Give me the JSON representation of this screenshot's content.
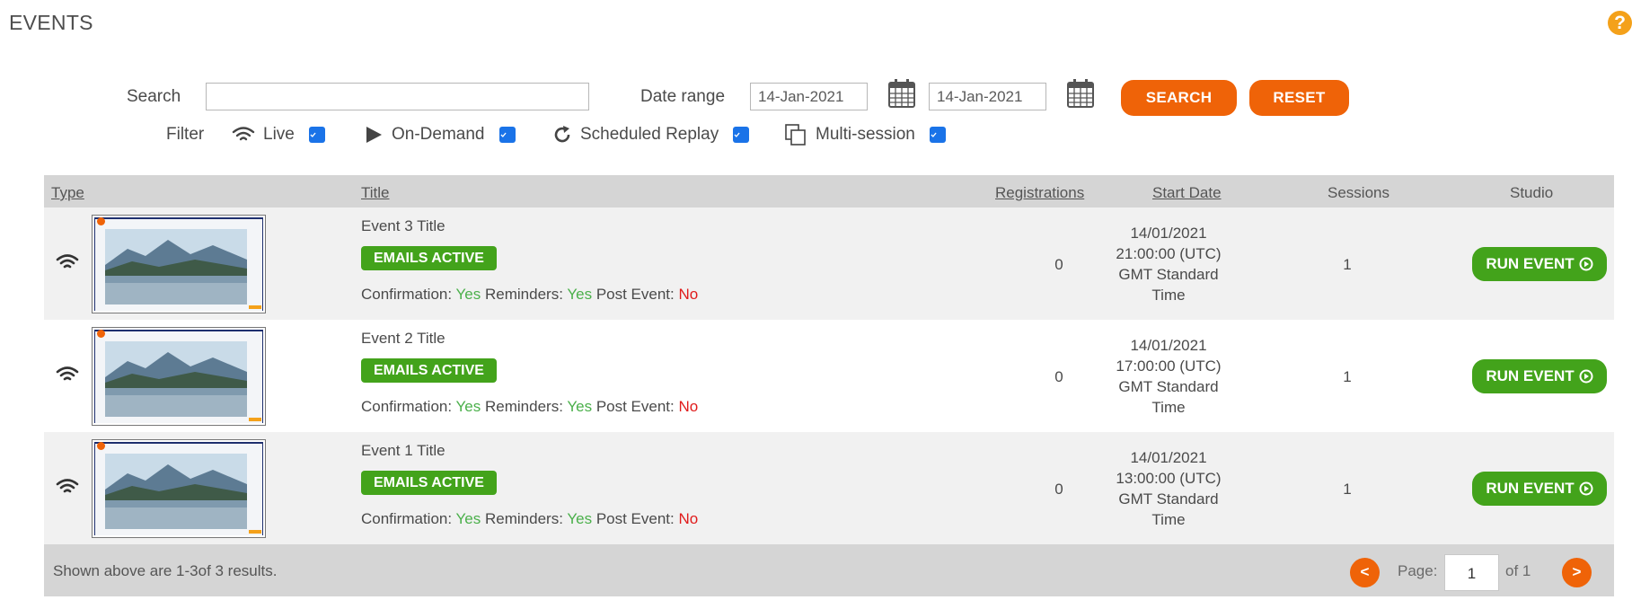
{
  "page": {
    "title": "EVENTS",
    "help_symbol": "?"
  },
  "search": {
    "label": "Search",
    "value": "",
    "placeholder": ""
  },
  "date_range": {
    "label": "Date range",
    "from": "14-Jan-2021",
    "to": "14-Jan-2021"
  },
  "buttons": {
    "search": "SEARCH",
    "reset": "RESET"
  },
  "filter": {
    "label": "Filter",
    "items": [
      {
        "label": "Live",
        "icon": "wifi-icon",
        "checked": true
      },
      {
        "label": "On-Demand",
        "icon": "play-icon",
        "checked": true
      },
      {
        "label": "Scheduled Replay",
        "icon": "replay-icon",
        "checked": true
      },
      {
        "label": "Multi-session",
        "icon": "copy-icon",
        "checked": true
      }
    ]
  },
  "table": {
    "headers": {
      "type": "Type",
      "title": "Title",
      "registrations": "Registrations",
      "start_date": "Start Date",
      "sessions": "Sessions",
      "studio": "Studio"
    },
    "rows": [
      {
        "title": "Event 3 Title",
        "badge": "EMAILS ACTIVE",
        "confirmation_label": "Confirmation:",
        "confirmation": "Yes",
        "reminders_label": "Reminders:",
        "reminders": "Yes",
        "post_event_label": "Post Event:",
        "post_event": "No",
        "registrations": "0",
        "date": "14/01/2021",
        "time": "21:00:00 (UTC)",
        "tz1": "GMT Standard",
        "tz2": "Time",
        "sessions": "1",
        "action": "RUN EVENT"
      },
      {
        "title": "Event 2 Title",
        "badge": "EMAILS ACTIVE",
        "confirmation_label": "Confirmation:",
        "confirmation": "Yes",
        "reminders_label": "Reminders:",
        "reminders": "Yes",
        "post_event_label": "Post Event:",
        "post_event": "No",
        "registrations": "0",
        "date": "14/01/2021",
        "time": "17:00:00 (UTC)",
        "tz1": "GMT Standard",
        "tz2": "Time",
        "sessions": "1",
        "action": "RUN EVENT"
      },
      {
        "title": "Event 1 Title",
        "badge": "EMAILS ACTIVE",
        "confirmation_label": "Confirmation:",
        "confirmation": "Yes",
        "reminders_label": "Reminders:",
        "reminders": "Yes",
        "post_event_label": "Post Event:",
        "post_event": "No",
        "registrations": "0",
        "date": "14/01/2021",
        "time": "13:00:00 (UTC)",
        "tz1": "GMT Standard",
        "tz2": "Time",
        "sessions": "1",
        "action": "RUN EVENT"
      }
    ]
  },
  "footer": {
    "results": "Shown above are 1-3of 3 results.",
    "prev": "<",
    "next": ">",
    "page_label": "Page:",
    "page": "1",
    "of": "of 1"
  },
  "colors": {
    "accent_orange": "#ef6308",
    "action_green": "#43a31b",
    "yes_green": "#4bb04b",
    "no_red": "#e01b1b",
    "help_orange": "#f4a11a",
    "checkbox_blue": "#1a73e8"
  }
}
